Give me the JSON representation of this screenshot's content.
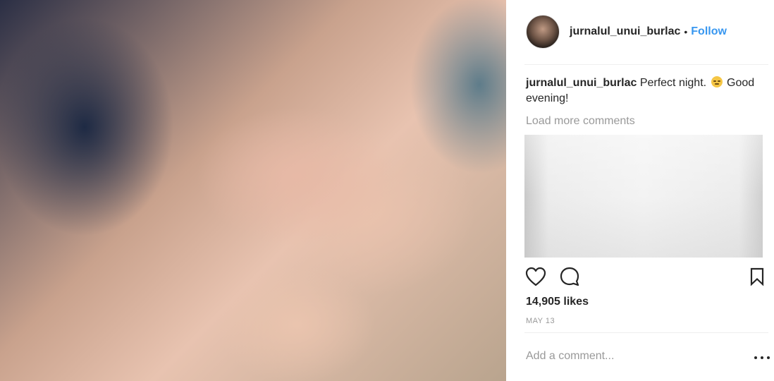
{
  "post": {
    "username": "jurnalul_unui_burlac",
    "separator": "•",
    "follow_label": "Follow",
    "caption": {
      "username": "jurnalul_unui_burlac",
      "text_before_emoji": "Perfect night.",
      "emoji": "relieved-face-emoji",
      "text_after_emoji": "Good evening!"
    },
    "load_more_label": "Load more comments",
    "likes": "14,905 likes",
    "date": "MAY 13",
    "add_comment_placeholder": "Add a comment...",
    "icons": {
      "like": "heart-icon",
      "comment": "comment-icon",
      "save": "bookmark-icon",
      "more": "more-options-icon"
    },
    "colors": {
      "link": "#3897f0",
      "text": "#262626",
      "muted": "#999999"
    }
  }
}
